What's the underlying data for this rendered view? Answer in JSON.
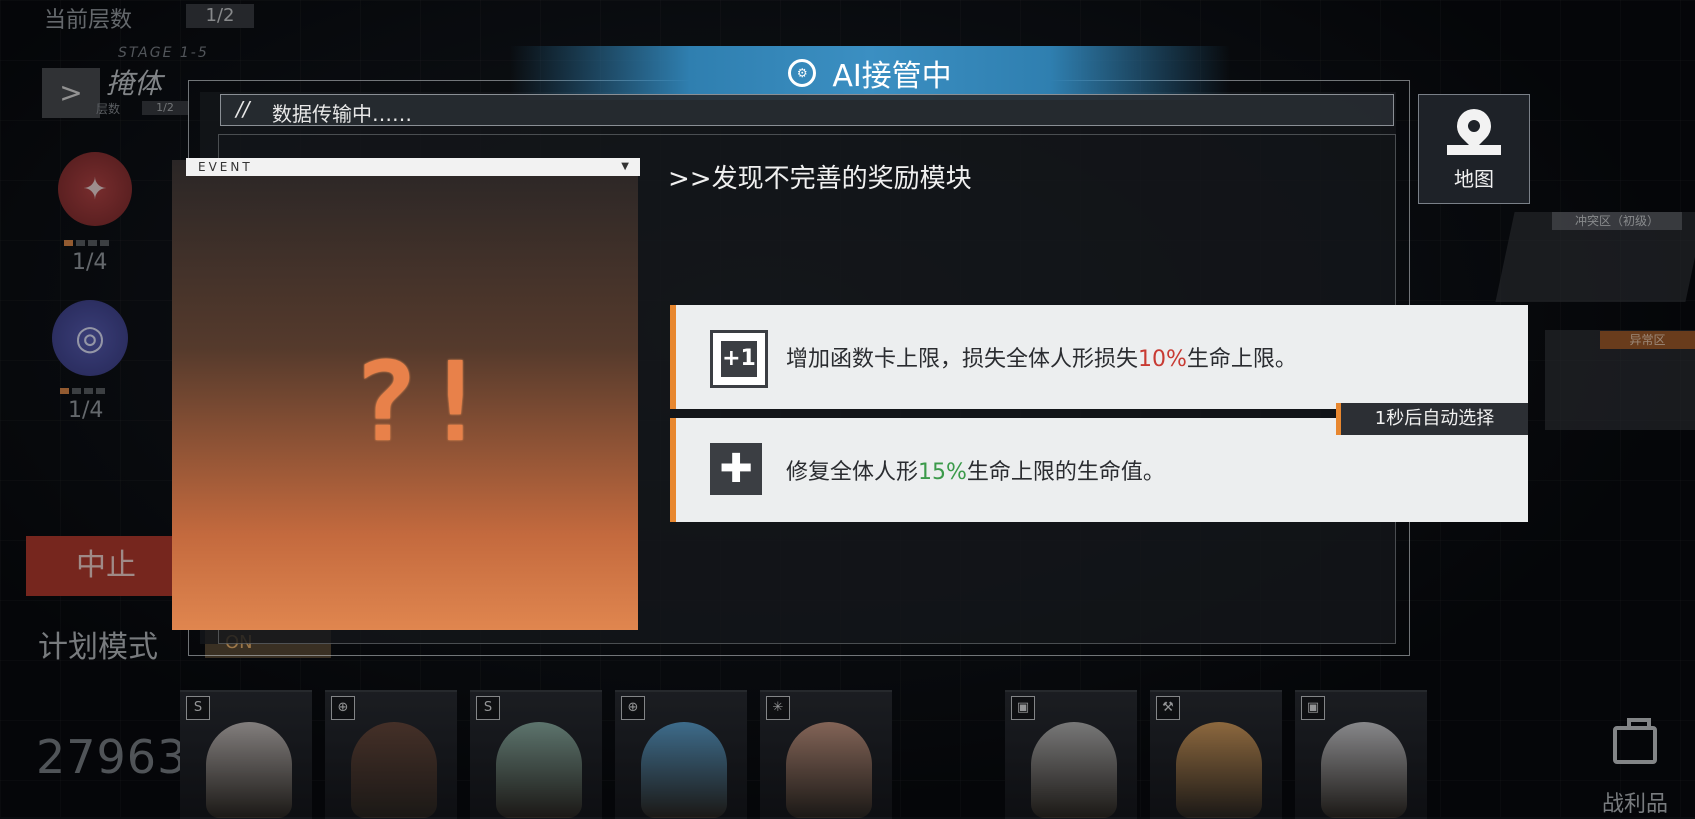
{
  "hud": {
    "floor_label": "当前层数",
    "floor_value": "1/2",
    "stage_code": "STAGE 1-5",
    "nav_arrow": ">",
    "cover_label": "掩体",
    "cover_sub_label": "层数",
    "cover_sub_value": "1/2",
    "skill_a_count": "1/4",
    "skill_b_count": "1/4",
    "abort_label": "中止",
    "plan_mode_label": "计划模式",
    "plan_mode_value": "ON",
    "score": "27963"
  },
  "modal": {
    "ai_title": "AI接管中",
    "transfer_slash": "//",
    "transfer_text": "数据传输中……",
    "event_header": "EVENT",
    "event_symbol": "?!",
    "event_title": ">>发现不完善的奖励模块",
    "options": [
      {
        "icon": "+1",
        "text_pre": "增加函数卡上限，损失全体人形损失",
        "highlight": "10%",
        "text_post": "生命上限。"
      },
      {
        "icon": "✚",
        "text_pre": "修复全体人形",
        "highlight": "15%",
        "text_post": "生命上限的生命值。"
      }
    ],
    "auto_select": "1秒后自动选择"
  },
  "map_button": {
    "label": "地图"
  },
  "spoils": {
    "label": "战利品"
  },
  "zones": {
    "zone1": "冲突区（初级）",
    "zone2": "异常区"
  },
  "characters": [
    {
      "class_icon": "S",
      "color": "#c8c2c0"
    },
    {
      "class_icon": "⊕",
      "color": "#6a4a3e"
    },
    {
      "class_icon": "S",
      "color": "#8fb3a8"
    },
    {
      "class_icon": "⊕",
      "color": "#5fa6d6"
    },
    {
      "class_icon": "✳",
      "color": "#c99a86"
    },
    {
      "class_icon": "▣",
      "color": "#b8b8b8"
    },
    {
      "class_icon": "⚒",
      "color": "#d8a060"
    },
    {
      "class_icon": "▣",
      "color": "#d0d0d4"
    }
  ],
  "colors": {
    "accent_orange": "#e8872f",
    "highlight_red": "#c83b33",
    "highlight_green": "#3b9a4a",
    "banner_blue": "#3b8fc2",
    "abort_red": "#b63b2e"
  }
}
